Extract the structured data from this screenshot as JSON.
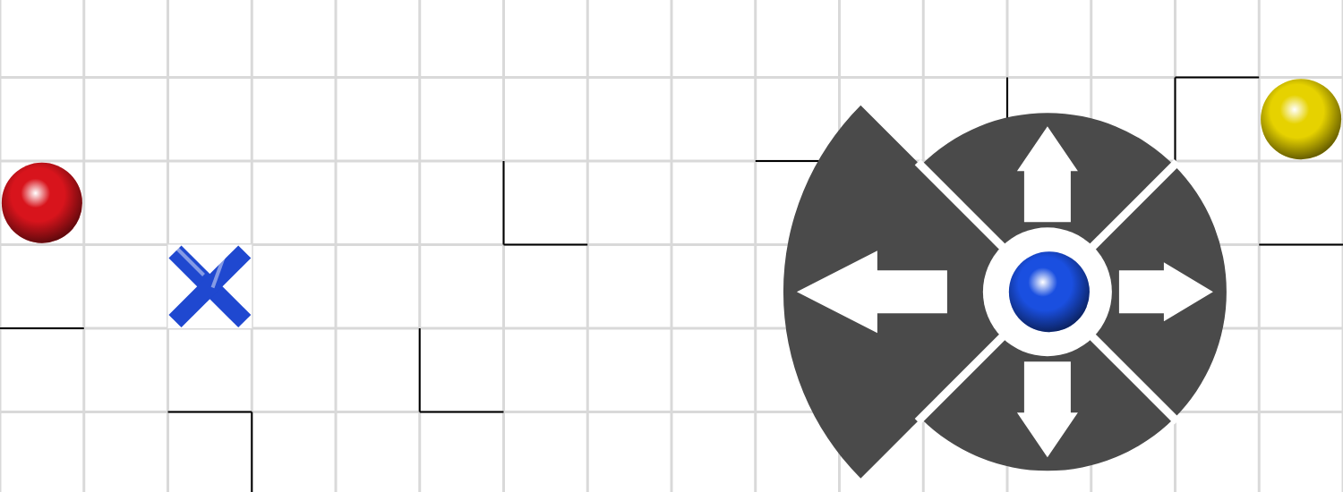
{
  "game": {
    "grid": {
      "columns": 16,
      "rows": 6
    },
    "balls": [
      {
        "name": "red",
        "color": "#d8141c",
        "col": 0,
        "row": 2,
        "controlled": false
      },
      {
        "name": "yellow",
        "color": "#e6d200",
        "col": 15,
        "row": 1,
        "controlled": false
      },
      {
        "name": "blue",
        "color": "#1a4fe0",
        "col": 12,
        "row": 3,
        "controlled": true
      }
    ],
    "target": {
      "col": 2,
      "row": 3,
      "color": "#1f48d0"
    },
    "walls": [
      {
        "col": 0,
        "row": 3,
        "side": "bottom"
      },
      {
        "col": 2,
        "row": 5,
        "side": "top"
      },
      {
        "col": 2,
        "row": 5,
        "side": "right"
      },
      {
        "col": 6,
        "row": 2,
        "side": "left"
      },
      {
        "col": 6,
        "row": 2,
        "side": "bottom"
      },
      {
        "col": 5,
        "row": 4,
        "side": "left"
      },
      {
        "col": 5,
        "row": 4,
        "side": "bottom"
      },
      {
        "col": 9,
        "row": 1,
        "side": "bottom"
      },
      {
        "col": 12,
        "row": 1,
        "side": "left"
      },
      {
        "col": 14,
        "row": 1,
        "side": "left"
      },
      {
        "col": 14,
        "row": 0,
        "side": "bottom"
      },
      {
        "col": 15,
        "row": 2,
        "side": "bottom"
      }
    ]
  },
  "dpad": {
    "buttons": [
      {
        "kind": "up"
      },
      {
        "kind": "right"
      },
      {
        "kind": "down"
      },
      {
        "kind": "left"
      }
    ]
  }
}
